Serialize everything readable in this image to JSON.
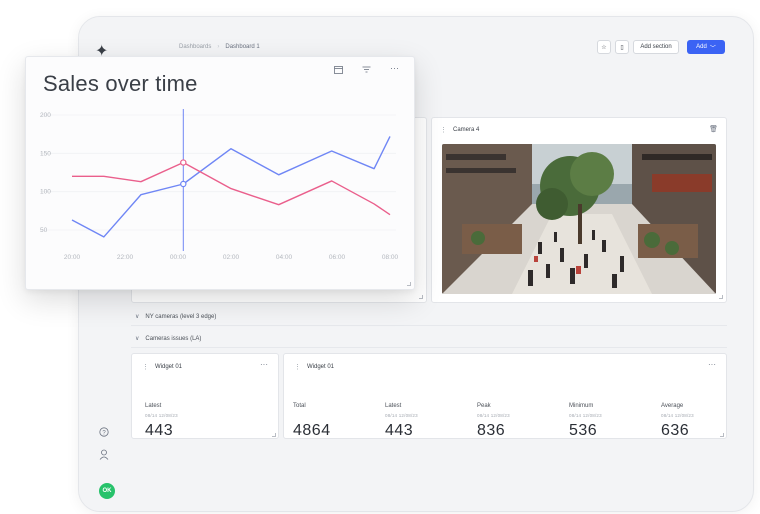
{
  "breadcrumb": {
    "parent": "Dashboards",
    "current": "Dashboard 1"
  },
  "toolbar": {
    "add_section_label": "Add section",
    "add_label": "Add"
  },
  "camera": {
    "title": "Camera 4"
  },
  "sections": [
    {
      "label": "NY cameras (level 3 edge)"
    },
    {
      "label": "Cameras issues (LA)"
    }
  ],
  "widget_small": {
    "title": "Widget 01",
    "stat": {
      "label": "Latest",
      "date": "08/14 12/08/23",
      "value": "443"
    }
  },
  "widget_large": {
    "title": "Widget 01",
    "stats": [
      {
        "label": "Total",
        "date": "",
        "value": "4864"
      },
      {
        "label": "Latest",
        "date": "08/14 12/08/23",
        "value": "443"
      },
      {
        "label": "Peak",
        "date": "08/14 12/08/23",
        "value": "836"
      },
      {
        "label": "Minimum",
        "date": "08/14 12/08/23",
        "value": "536"
      },
      {
        "label": "Average",
        "date": "08/14 12/08/23",
        "value": "636"
      }
    ]
  },
  "sidebar": {
    "avatar_initials": "OK"
  },
  "colors": {
    "accent": "#3b63f4",
    "blue_series": "#6f86f5",
    "pink_series": "#ea5f8c",
    "avatar": "#27c26b"
  },
  "icons": [
    "logo-icon",
    "help-icon",
    "user-icon",
    "calendar-icon",
    "filter-icon",
    "more-icon",
    "star-icon",
    "bell-icon",
    "trash-icon",
    "chevron-down-icon",
    "drag-icon"
  ],
  "chart_data": {
    "type": "line",
    "title": "Sales over time",
    "categories": [
      "20:00",
      "22:00",
      "00:00",
      "02:00",
      "04:00",
      "06:00",
      "08:00"
    ],
    "y_ticks": [
      50,
      100,
      150,
      200
    ],
    "ylim": [
      20,
      200
    ],
    "series": [
      {
        "color": "#6f86f5",
        "x": [
          0,
          0.6,
          1.3,
          2.1,
          3.0,
          3.9,
          4.9,
          5.7,
          6.0
        ],
        "y": [
          63,
          41,
          96,
          110,
          156,
          122,
          153,
          130,
          172
        ]
      },
      {
        "color": "#ea5f8c",
        "x": [
          0,
          0.6,
          1.3,
          2.1,
          3.0,
          3.9,
          4.9,
          5.7,
          6.0
        ],
        "y": [
          120,
          120,
          113,
          138,
          104,
          83,
          114,
          84,
          70
        ]
      }
    ],
    "cursor": {
      "x": 2.1
    },
    "grid": true,
    "legend": "none"
  }
}
